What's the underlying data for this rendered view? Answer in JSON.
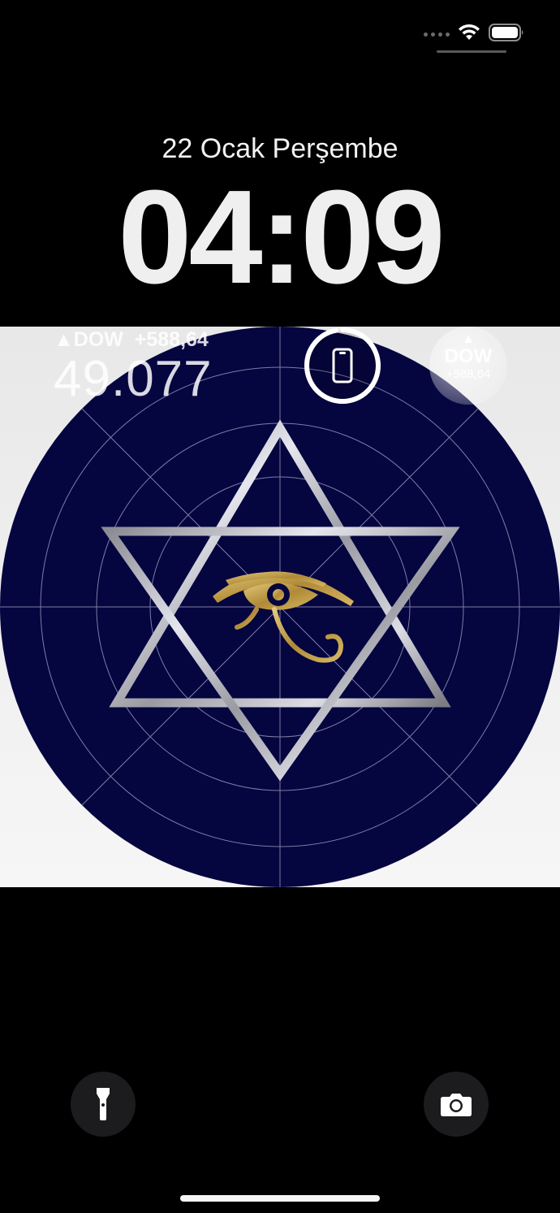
{
  "status": {
    "signal_icon": "signal-dots-icon",
    "wifi_icon": "wifi-icon",
    "battery_icon": "battery-icon"
  },
  "lockscreen": {
    "date": "22 Ocak Perşembe",
    "time": "04:09"
  },
  "widgets": {
    "stock": {
      "arrow": "▲",
      "symbol": "DOW",
      "change": "+588,64",
      "value": "49.077"
    },
    "battery": {
      "icon": "phone-icon",
      "level_fraction": 0.97
    },
    "dow_bubble": {
      "arrow": "▲",
      "symbol": "DOW",
      "change": "+588,64"
    }
  },
  "quick_actions": {
    "flashlight_icon": "flashlight-icon",
    "camera_icon": "camera-icon"
  },
  "colors": {
    "wallpaper_circle": "#050540",
    "wallpaper_bg": "#f2f2f2",
    "eye_gold": "#c2a14c",
    "star_silver": "#b8b8c0"
  }
}
